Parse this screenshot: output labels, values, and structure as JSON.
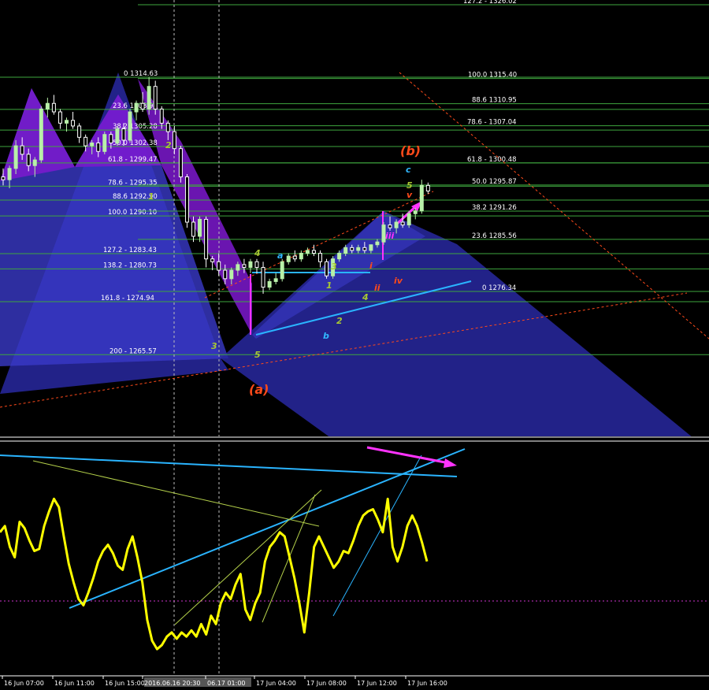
{
  "chart_data": [
    {
      "type": "candlestick",
      "instrument_unit": "price",
      "ylim": [
        1262,
        1327
      ],
      "fib_levels_left": [
        {
          "label": "0 1314.63",
          "price": 1314.63
        },
        {
          "label": "23.6 1308.94",
          "price": 1308.94
        },
        {
          "label": "38.2 1305.28",
          "price": 1305.28
        },
        {
          "label": "50.0 1302.38",
          "price": 1302.38
        },
        {
          "label": "61.8 - 1299.47",
          "price": 1299.47
        },
        {
          "label": "78.6 - 1295.35",
          "price": 1295.35
        },
        {
          "label": "88.6 1292.90",
          "price": 1292.9
        },
        {
          "label": "100.0 1290.10",
          "price": 1290.1
        },
        {
          "label": "127.2 - 1283.43",
          "price": 1283.43
        },
        {
          "label": "138.2 - 1280.73",
          "price": 1280.73
        },
        {
          "label": "161.8 - 1274.94",
          "price": 1274.94
        },
        {
          "label": "200 - 1265.57",
          "price": 1265.57
        }
      ],
      "fib_levels_right": [
        {
          "label": "127.2 - 1326.02",
          "price": 1326.02
        },
        {
          "label": "100.0 1315.40",
          "price": 1315.4
        },
        {
          "label": "88.6 1310.95",
          "price": 1310.95
        },
        {
          "label": "78.6 - 1307.04",
          "price": 1307.04
        },
        {
          "label": "61.8 - 1300.48",
          "price": 1300.48
        },
        {
          "label": "50.0 1295.87",
          "price": 1295.87
        },
        {
          "label": "38.2 1291.26",
          "price": 1291.26
        },
        {
          "label": "23.6 1285.56",
          "price": 1285.56
        },
        {
          "label": "0 1276.34",
          "price": 1276.34
        }
      ],
      "candles": [
        [
          1297.0,
          1298.5,
          1295.5,
          1296.5
        ],
        [
          1296.5,
          1299.0,
          1295.0,
          1298.5
        ],
        [
          1298.5,
          1303.5,
          1297.5,
          1302.5
        ],
        [
          1302.5,
          1304.0,
          1300.0,
          1301.0
        ],
        [
          1301.0,
          1302.0,
          1298.0,
          1299.0
        ],
        [
          1299.0,
          1300.5,
          1297.0,
          1300.0
        ],
        [
          1300.0,
          1309.5,
          1299.5,
          1309.0
        ],
        [
          1309.0,
          1311.0,
          1307.5,
          1310.0
        ],
        [
          1310.0,
          1311.5,
          1308.0,
          1308.5
        ],
        [
          1308.5,
          1309.0,
          1305.5,
          1306.5
        ],
        [
          1306.5,
          1307.5,
          1305.0,
          1307.0
        ],
        [
          1307.0,
          1308.5,
          1305.5,
          1306.0
        ],
        [
          1306.0,
          1306.5,
          1303.0,
          1304.0
        ],
        [
          1304.0,
          1304.5,
          1301.5,
          1302.5
        ],
        [
          1302.5,
          1303.5,
          1301.0,
          1303.0
        ],
        [
          1303.0,
          1304.0,
          1300.5,
          1301.5
        ],
        [
          1301.5,
          1305.0,
          1301.0,
          1304.5
        ],
        [
          1304.5,
          1305.0,
          1302.0,
          1303.0
        ],
        [
          1303.0,
          1306.0,
          1302.5,
          1305.5
        ],
        [
          1305.5,
          1306.5,
          1302.5,
          1303.5
        ],
        [
          1303.5,
          1309.0,
          1303.0,
          1308.5
        ],
        [
          1308.5,
          1310.5,
          1307.0,
          1310.0
        ],
        [
          1310.0,
          1312.0,
          1308.5,
          1309.0
        ],
        [
          1309.0,
          1314.63,
          1308.0,
          1313.0
        ],
        [
          1313.0,
          1314.0,
          1308.0,
          1309.0
        ],
        [
          1309.0,
          1309.5,
          1305.5,
          1306.5
        ],
        [
          1306.5,
          1307.0,
          1303.5,
          1305.0
        ],
        [
          1305.0,
          1306.0,
          1301.0,
          1302.0
        ],
        [
          1302.0,
          1302.5,
          1296.0,
          1297.0
        ],
        [
          1297.0,
          1297.5,
          1288.0,
          1289.0
        ],
        [
          1289.0,
          1290.0,
          1285.5,
          1286.5
        ],
        [
          1286.5,
          1290.0,
          1285.5,
          1289.5
        ],
        [
          1289.5,
          1290.0,
          1281.0,
          1282.5
        ],
        [
          1282.5,
          1283.0,
          1280.5,
          1282.0
        ],
        [
          1282.0,
          1283.5,
          1279.5,
          1280.5
        ],
        [
          1280.5,
          1281.5,
          1278.0,
          1279.0
        ],
        [
          1279.0,
          1281.0,
          1278.0,
          1280.5
        ],
        [
          1280.5,
          1282.0,
          1279.5,
          1281.5
        ],
        [
          1281.5,
          1282.5,
          1280.0,
          1281.0
        ],
        [
          1281.0,
          1282.5,
          1280.0,
          1282.0
        ],
        [
          1282.0,
          1282.5,
          1280.0,
          1281.0
        ],
        [
          1281.0,
          1282.0,
          1276.34,
          1277.5
        ],
        [
          1277.5,
          1279.0,
          1277.0,
          1278.5
        ],
        [
          1278.5,
          1280.0,
          1278.0,
          1279.0
        ],
        [
          1279.0,
          1282.5,
          1278.5,
          1282.0
        ],
        [
          1282.0,
          1283.5,
          1281.5,
          1283.0
        ],
        [
          1283.0,
          1284.0,
          1282.0,
          1282.5
        ],
        [
          1282.5,
          1284.0,
          1282.0,
          1283.5
        ],
        [
          1283.5,
          1284.5,
          1283.0,
          1284.0
        ],
        [
          1284.0,
          1285.0,
          1283.0,
          1283.5
        ],
        [
          1283.5,
          1284.0,
          1281.0,
          1282.0
        ],
        [
          1282.0,
          1282.5,
          1279.0,
          1279.5
        ],
        [
          1279.5,
          1283.0,
          1279.0,
          1282.5
        ],
        [
          1282.5,
          1284.0,
          1282.0,
          1283.5
        ],
        [
          1283.5,
          1285.0,
          1283.0,
          1284.5
        ],
        [
          1284.5,
          1285.0,
          1283.5,
          1284.0
        ],
        [
          1284.0,
          1285.0,
          1283.5,
          1284.5
        ],
        [
          1284.5,
          1285.5,
          1283.5,
          1284.0
        ],
        [
          1284.0,
          1285.0,
          1283.5,
          1285.0
        ],
        [
          1285.0,
          1286.0,
          1284.5,
          1285.5
        ],
        [
          1285.5,
          1289.0,
          1285.0,
          1288.5
        ],
        [
          1288.5,
          1290.0,
          1287.5,
          1288.0
        ],
        [
          1288.0,
          1289.5,
          1287.0,
          1289.0
        ],
        [
          1289.0,
          1290.5,
          1288.0,
          1288.5
        ],
        [
          1288.5,
          1291.0,
          1288.0,
          1290.5
        ],
        [
          1290.5,
          1291.5,
          1289.5,
          1291.0
        ],
        [
          1291.0,
          1296.5,
          1290.5,
          1295.5
        ],
        [
          1295.5,
          1296.0,
          1294.0,
          1294.5
        ]
      ]
    },
    {
      "type": "line",
      "series": [
        {
          "values": [
            62,
            65,
            55,
            50,
            67,
            64,
            58,
            53,
            54,
            65,
            72,
            78,
            74,
            60,
            47,
            38,
            30,
            27,
            33,
            40,
            48,
            53,
            56,
            52,
            46,
            44,
            54,
            60,
            50,
            38,
            20,
            10,
            6,
            8,
            12,
            14,
            11,
            14,
            12,
            15,
            12,
            18,
            13,
            22,
            18,
            28,
            33,
            30,
            37,
            42,
            25,
            20,
            28,
            33,
            48,
            55,
            58,
            62,
            60,
            50,
            40,
            28,
            14,
            33,
            55,
            60,
            55,
            50,
            45,
            48,
            53,
            52,
            58,
            65,
            70,
            72,
            73,
            68,
            62,
            78,
            55,
            48,
            55,
            65,
            70,
            65,
            57,
            48
          ]
        }
      ],
      "ylim": [
        0,
        100
      ]
    }
  ],
  "price_chart": {
    "wave_labels": [
      {
        "text": "(b)",
        "color": "#ff4a1a",
        "big": true
      },
      {
        "text": "c",
        "color": "#31b8ff"
      },
      {
        "text": "5",
        "color": "#a8c832"
      },
      {
        "text": "v",
        "color": "#ff4a1a"
      },
      {
        "text": "iii",
        "color": "#ff33ff"
      },
      {
        "text": "i",
        "color": "#ff4a1a"
      },
      {
        "text": "ii",
        "color": "#ff4a1a"
      },
      {
        "text": "iv",
        "color": "#ff4a1a"
      },
      {
        "text": "4",
        "color": "#a8c832"
      },
      {
        "text": "a",
        "color": "#31b8ff"
      },
      {
        "text": "3",
        "color": "#a8c832"
      },
      {
        "text": "1",
        "color": "#a8c832"
      },
      {
        "text": "4",
        "color": "#a8c832"
      },
      {
        "text": "2",
        "color": "#a8c832"
      },
      {
        "text": "b",
        "color": "#31b8ff"
      },
      {
        "text": "5",
        "color": "#a8c832"
      },
      {
        "text": "3",
        "color": "#a8c832"
      },
      {
        "text": "(a)",
        "color": "#ff4a1a",
        "big": true
      },
      {
        "text": "2",
        "color": "#a8c832"
      },
      {
        "text": "1",
        "color": "#a8c832"
      }
    ]
  },
  "time_axis": {
    "ticks": [
      "16 Jun 07:00",
      "16 Jun 11:00",
      "16 Jun 15:00",
      "2016.06.16 20:30",
      "06.17 01:00",
      "17 Jun 04:00",
      "17 Jun 08:00",
      "17 Jun 12:00",
      "17 Jun 16:00"
    ]
  },
  "colors": {
    "background": "#000000",
    "fib_line": "#3ea63e",
    "candle_bull": "#b8f0a8",
    "candle_bear": "#ffffff",
    "oscillator": "#ffff00",
    "trendline_blue": "#2ab4ff",
    "trendline_green": "#b4d04a",
    "arrow_magenta": "#ff33ff",
    "shape_purple": "#7d19cf",
    "shape_blue": "#2828a0"
  }
}
